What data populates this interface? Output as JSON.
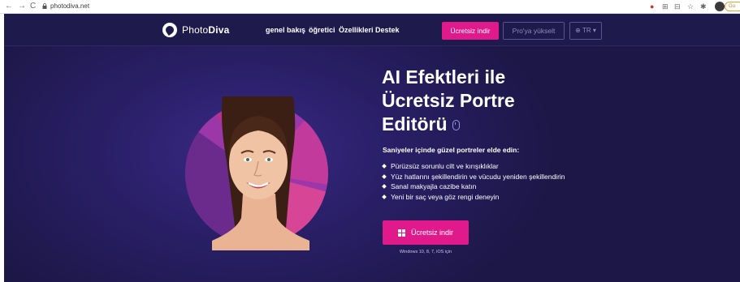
{
  "browser": {
    "url": "photodiva.net",
    "profile_pill": "Gu"
  },
  "header": {
    "logo_prefix": "Photo",
    "logo_brand": "Diva",
    "nav": [
      "genel bakış",
      "öğretici",
      "Özellikleri",
      "Destek"
    ],
    "download_button": "Ücretsiz indir",
    "upgrade_button": "Pro'ya yükselt",
    "language_button": "⊕ TR ▾"
  },
  "hero": {
    "title_line1": "AI Efektleri ile",
    "title_line2": "Ücretsiz Portre",
    "title_line3": "Editörü",
    "subtitle": "Saniyeler içinde güzel portreler elde edin:",
    "features": [
      "Pürüzsüz sorunlu cilt ve kırışıklıklar",
      "Yüz hatlarını şekillendirin ve vücudu yeniden şekillendirin",
      "Sanal makyajla cazibe katın",
      "Yeni bir saç veya göz rengi deneyin"
    ],
    "cta_label": "Ücretsiz indir",
    "platform_note": "Windows 10, 8, 7, iOS için"
  },
  "colors": {
    "accent": "#e11a8c",
    "background": "#1d1747",
    "header_bg": "#1f1a4c"
  }
}
